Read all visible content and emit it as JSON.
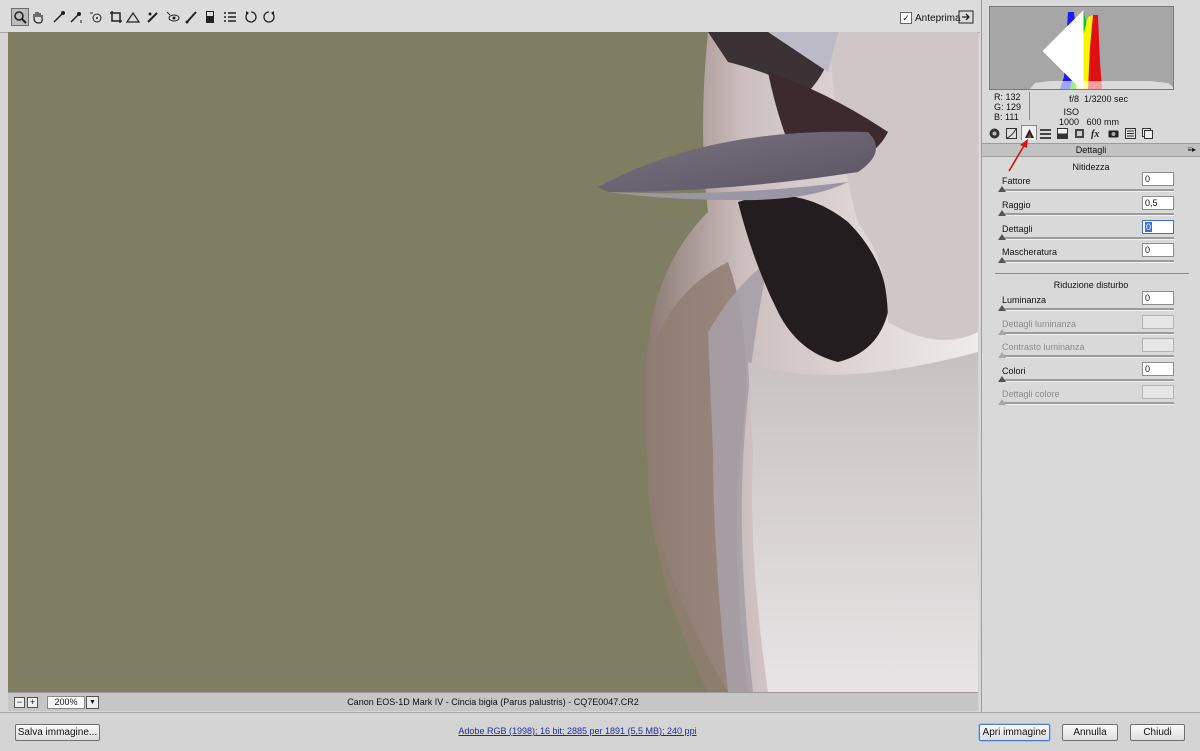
{
  "toolbar": {
    "tools": [
      {
        "icon": "zoom-icon"
      },
      {
        "icon": "hand-icon"
      },
      {
        "icon": "white-balance-icon"
      },
      {
        "icon": "color-sampler-icon"
      },
      {
        "icon": "target-adjust-icon"
      },
      {
        "icon": "crop-icon"
      },
      {
        "icon": "straighten-icon"
      },
      {
        "icon": "spot-removal-icon"
      },
      {
        "icon": "red-eye-icon"
      },
      {
        "icon": "adjustment-brush-icon"
      },
      {
        "icon": "graduated-filter-icon"
      },
      {
        "icon": "preferences-icon"
      },
      {
        "icon": "rotate-left-icon"
      },
      {
        "icon": "rotate-right-icon"
      }
    ],
    "preview_label": "Anteprima",
    "preview_checked": true
  },
  "statusbar": {
    "zoom_minus": "−",
    "zoom_plus": "+",
    "zoom_value": "200%",
    "file_info": "Canon EOS-1D Mark IV  -  Cincia bigia (Parus palustris) - CQ7E0047.CR2"
  },
  "panel": {
    "rgb": {
      "r_label": "R:",
      "r": "132",
      "g_label": "G:",
      "g": "129",
      "b_label": "B:",
      "b": "111"
    },
    "exif": {
      "aperture": "f/8",
      "shutter": "1/3200 sec",
      "iso": "ISO 1000",
      "focal": "600 mm"
    },
    "tabs": [
      {
        "icon": "basic-icon"
      },
      {
        "icon": "tone-curve-icon"
      },
      {
        "icon": "detail-icon",
        "active": true
      },
      {
        "icon": "hsl-icon"
      },
      {
        "icon": "split-toning-icon"
      },
      {
        "icon": "lens-corrections-icon"
      },
      {
        "icon": "effects-icon"
      },
      {
        "icon": "camera-calibration-icon"
      },
      {
        "icon": "presets-icon"
      },
      {
        "icon": "snapshots-icon"
      }
    ],
    "section_title": "Dettagli",
    "sharpening": {
      "title": "Nitidezza",
      "sliders": [
        {
          "label": "Fattore",
          "value": "0",
          "level": 0,
          "enabled": true
        },
        {
          "label": "Raggio",
          "value": "0,5",
          "level": 0,
          "enabled": true
        },
        {
          "label": "Dettagli",
          "value": "0",
          "level": 0,
          "enabled": true,
          "focused": true
        },
        {
          "label": "Mascheratura",
          "value": "0",
          "level": 0,
          "enabled": true
        }
      ]
    },
    "noise": {
      "title": "Riduzione disturbo",
      "sliders": [
        {
          "label": "Luminanza",
          "value": "0",
          "level": 0,
          "enabled": true
        },
        {
          "label": "Dettagli luminanza",
          "value": "",
          "level": 0,
          "enabled": false
        },
        {
          "label": "Contrasto luminanza",
          "value": "",
          "level": 0,
          "enabled": false
        },
        {
          "label": "Colori",
          "value": "0",
          "level": 0,
          "enabled": true
        },
        {
          "label": "Dettagli colore",
          "value": "",
          "level": 0,
          "enabled": false
        }
      ]
    }
  },
  "bottom": {
    "save_label": "Salva immagine...",
    "workflow_label": "Adobe RGB (1998); 16 bit; 2885 per 1891 (5,5 MB); 240 ppi",
    "open_label": "Apri immagine",
    "cancel_label": "Annulla",
    "close_label": "Chiudi"
  },
  "colors": {
    "background": "#7f7e62",
    "accent": "#3a6ed0",
    "annotation_arrow": "#d01818"
  }
}
